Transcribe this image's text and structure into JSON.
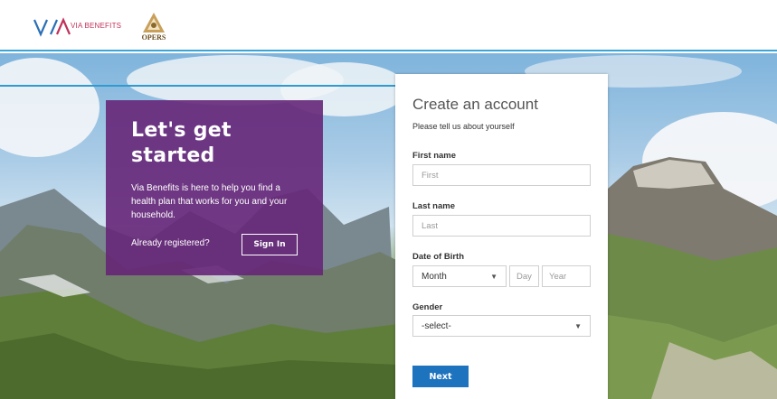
{
  "header": {
    "via_logo_text": "VIA",
    "via_sub_text": "VIA BENEFITS",
    "opers_text": "OPERS"
  },
  "promo": {
    "title": "Let's get started",
    "description": "Via Benefits is here to help you find a health plan that works for you and your household.",
    "already_text": "Already registered?",
    "signin_label": "Sign In"
  },
  "form": {
    "title": "Create an account",
    "subtitle": "Please tell us about yourself",
    "first_name_label": "First name",
    "first_name_placeholder": "First",
    "last_name_label": "Last name",
    "last_name_placeholder": "Last",
    "dob_label": "Date of Birth",
    "month_value": "Month",
    "day_placeholder": "Day",
    "year_placeholder": "Year",
    "gender_label": "Gender",
    "gender_value": "-select-",
    "next_label": "Next"
  },
  "colors": {
    "accent_blue": "#2f9bd0",
    "promo_purple": "#662678",
    "button_blue": "#1e73be",
    "via_magenta": "#c0325a"
  }
}
